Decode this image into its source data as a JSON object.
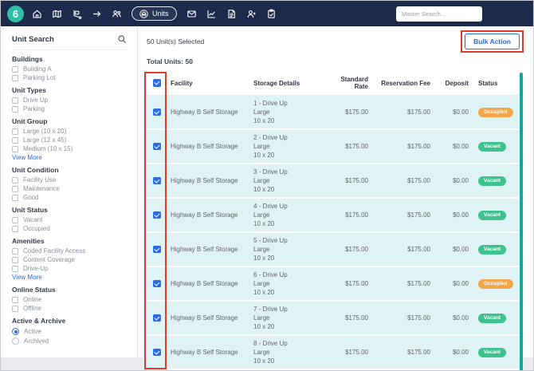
{
  "navbar": {
    "logo": "6",
    "units_label": "Units",
    "search_placeholder": "Master Search...",
    "icons": [
      "home-icon",
      "map-icon",
      "move-icon",
      "arrow-right-icon",
      "team-icon",
      "units-icon",
      "mail-icon",
      "reports-icon",
      "documents-icon",
      "contacts-icon",
      "tasks-icon"
    ]
  },
  "sidebar": {
    "title": "Unit Search",
    "search_icon": "search-icon",
    "sections": [
      {
        "title": "Buildings",
        "control": "checkbox",
        "options": [
          "Building A",
          "Parking Lot"
        ]
      },
      {
        "title": "Unit Types",
        "control": "checkbox",
        "options": [
          "Drive Up",
          "Parking"
        ]
      },
      {
        "title": "Unit Group",
        "control": "checkbox",
        "options": [
          "Large (10 x 20)",
          "Large (12 x 45)",
          "Medium (10 x 15)"
        ],
        "view_more": "View More"
      },
      {
        "title": "Unit Condition",
        "control": "checkbox",
        "options": [
          "Facility Use",
          "Maintenance",
          "Good"
        ]
      },
      {
        "title": "Unit Status",
        "control": "checkbox",
        "options": [
          "Vacant",
          "Occupied"
        ]
      },
      {
        "title": "Amenities",
        "control": "checkbox",
        "options": [
          "Coded Facility Access",
          "Content Coverage",
          "Drive-Up"
        ],
        "view_more": "View More"
      },
      {
        "title": "Online Status",
        "control": "checkbox",
        "options": [
          "Online",
          "Offline"
        ]
      },
      {
        "title": "Active & Archive",
        "control": "radio",
        "options": [
          "Active",
          "Archived"
        ],
        "selected": "Active"
      }
    ]
  },
  "main": {
    "selected_text": "50 Unit(s) Selected",
    "bulk_action": "Bulk Action",
    "total_units": "Total Units: 50",
    "table": {
      "headers": [
        "Facility",
        "Storage Details",
        "Standard Rate",
        "Reservation Fee",
        "Deposit",
        "Status"
      ],
      "all_selected": true,
      "rows": [
        {
          "facility": "Highway B Self Storage",
          "unit": "1 - Drive Up",
          "size": "Large",
          "dims": "10 x 20",
          "standard_rate": "$175.00",
          "reservation_fee": "$175.00",
          "deposit": "$0.00",
          "status": "Occupied",
          "selected": true
        },
        {
          "facility": "Highway B Self Storage",
          "unit": "2 - Drive Up",
          "size": "Large",
          "dims": "10 x 20",
          "standard_rate": "$175.00",
          "reservation_fee": "$175.00",
          "deposit": "$0.00",
          "status": "Vacant",
          "selected": true
        },
        {
          "facility": "Highway B Self Storage",
          "unit": "3 - Drive Up",
          "size": "Large",
          "dims": "10 x 20",
          "standard_rate": "$175.00",
          "reservation_fee": "$175.00",
          "deposit": "$0.00",
          "status": "Vacant",
          "selected": true
        },
        {
          "facility": "Highway B Self Storage",
          "unit": "4 - Drive Up",
          "size": "Large",
          "dims": "10 x 20",
          "standard_rate": "$175.00",
          "reservation_fee": "$175.00",
          "deposit": "$0.00",
          "status": "Vacant",
          "selected": true
        },
        {
          "facility": "Highway B Self Storage",
          "unit": "5 - Drive Up",
          "size": "Large",
          "dims": "10 x 20",
          "standard_rate": "$175.00",
          "reservation_fee": "$175.00",
          "deposit": "$0.00",
          "status": "Vacant",
          "selected": true
        },
        {
          "facility": "Highway B Self Storage",
          "unit": "6 - Drive Up",
          "size": "Large",
          "dims": "10 x 20",
          "standard_rate": "$175.00",
          "reservation_fee": "$175.00",
          "deposit": "$0.00",
          "status": "Occupied",
          "selected": true
        },
        {
          "facility": "Highway B Self Storage",
          "unit": "7 - Drive Up",
          "size": "Large",
          "dims": "10 x 20",
          "standard_rate": "$175.00",
          "reservation_fee": "$175.00",
          "deposit": "$0.00",
          "status": "Vacant",
          "selected": true
        },
        {
          "facility": "Highway B Self Storage",
          "unit": "8 - Drive Up",
          "size": "Large",
          "dims": "10 x 20",
          "standard_rate": "$175.00",
          "reservation_fee": "$175.00",
          "deposit": "$0.00",
          "status": "Vacant",
          "selected": true
        }
      ]
    }
  },
  "colors": {
    "navbar": "#1c2b4b",
    "brand_teal": "#2fbfa7",
    "primary_blue": "#2e6bd8",
    "status_occupied": "#f2a54a",
    "status_vacant": "#3ec28f",
    "selected_row": "#dff2f4",
    "annotation_red": "#e23b2e",
    "scrollbar_teal": "#16a79a"
  }
}
